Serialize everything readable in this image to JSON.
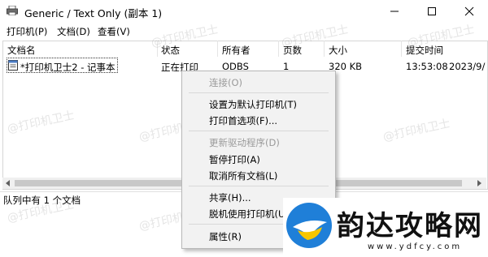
{
  "window": {
    "title": "Generic / Text Only (副本 1)"
  },
  "menubar": {
    "items": [
      "打印机(P)",
      "文档(D)",
      "查看(V)"
    ]
  },
  "columns": [
    "文档名",
    "状态",
    "所有者",
    "页数",
    "大小",
    "提交时间"
  ],
  "job": {
    "name": "*打印机卫士2 - 记事本",
    "status": "正在打印",
    "owner": "ODBS",
    "pages": "1",
    "size": "320 KB",
    "time": "13:53:08",
    "date": "2023/9/"
  },
  "status": {
    "text": "队列中有 1 个文档"
  },
  "context_menu": {
    "items": [
      {
        "label": "连接(O)",
        "disabled": true
      },
      {
        "label": "设置为默认打印机(T)",
        "disabled": false
      },
      {
        "label": "打印首选项(F)...",
        "disabled": false
      },
      {
        "label": "更新驱动程序(D)",
        "disabled": true
      },
      {
        "label": "暂停打印(A)",
        "disabled": false
      },
      {
        "label": "取消所有文档(L)",
        "disabled": false
      },
      {
        "label": "共享(H)...",
        "disabled": false
      },
      {
        "label": "脱机使用打印机(U)",
        "disabled": false
      },
      {
        "label": "属性(R)",
        "disabled": false
      }
    ]
  },
  "watermark": {
    "text": "@打印机卫士"
  },
  "logo": {
    "text": "韵达攻略网",
    "url": "www.ydfcy.com"
  },
  "colors": {
    "logo_blue": "#1f7fd8",
    "logo_yellow": "#f7c600"
  }
}
